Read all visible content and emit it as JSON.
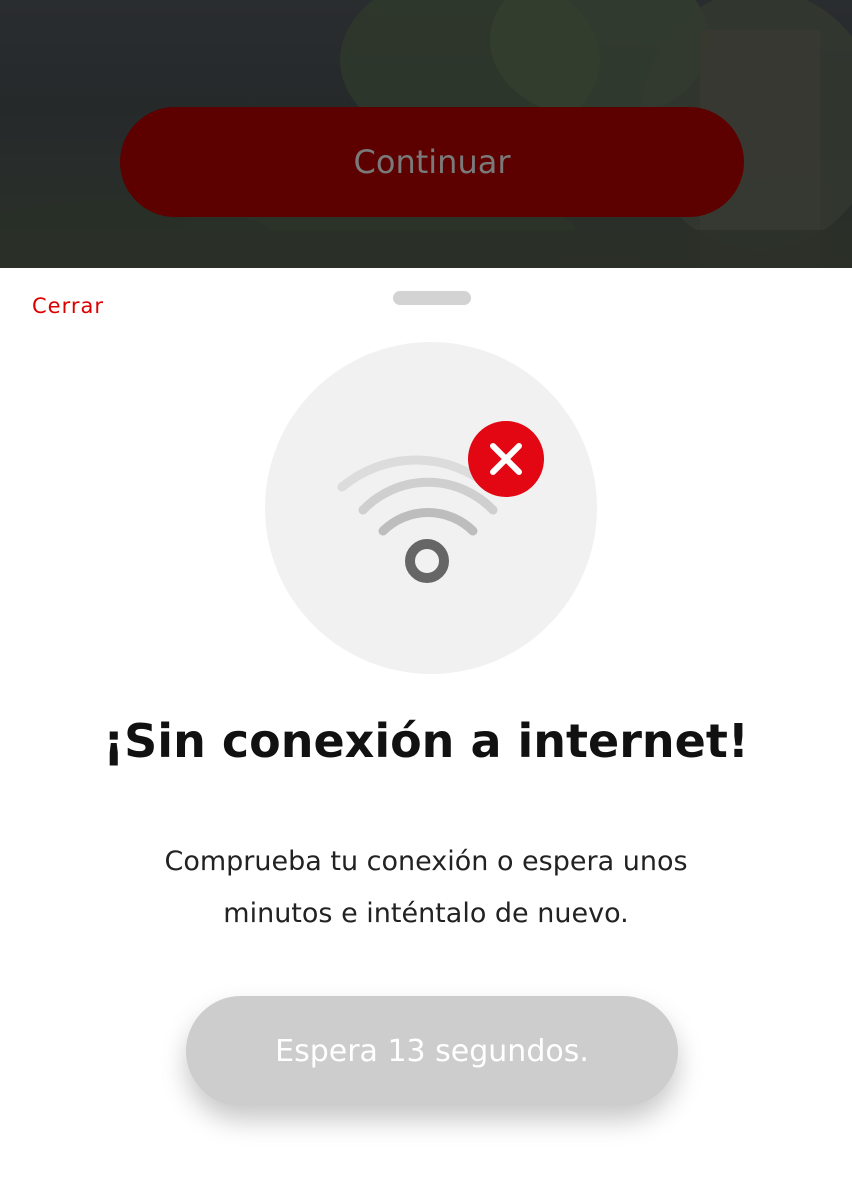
{
  "background": {
    "continue_label": "Continuar"
  },
  "sheet": {
    "close_label": "Cerrar",
    "title": "¡Sin conexión a internet!",
    "message_line1": "Comprueba tu conexión o espera unos",
    "message_line2": "minutos e inténtalo de nuevo.",
    "wait_button_label": "Espera 13 segundos."
  },
  "icons": {
    "illustration": "wifi-off-icon",
    "badge": "close-icon"
  },
  "colors": {
    "accent": "#dd0000",
    "continue_button": "#5c0000",
    "wait_button": "#cdcdcd",
    "illustration_bg": "#f1f1f1"
  }
}
